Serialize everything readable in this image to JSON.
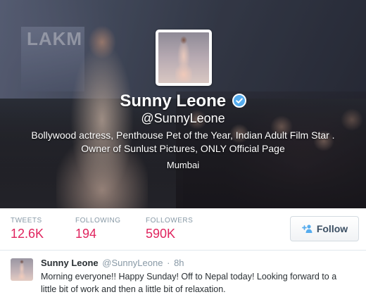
{
  "profile": {
    "name": "Sunny Leone",
    "handle": "@SunnyLeone",
    "bio_line1": "Bollywood actress, Penthouse Pet of the Year, Indian Adult Film Star .",
    "bio_line2": "Owner of Sunlust Pictures, ONLY Official Page",
    "location": "Mumbai",
    "banner_brand_text": "LAKM",
    "verified_icon": "verified-badge-icon"
  },
  "stats": [
    {
      "label": "TWEETS",
      "value": "12.6K"
    },
    {
      "label": "FOLLOWING",
      "value": "194"
    },
    {
      "label": "FOLLOWERS",
      "value": "590K"
    }
  ],
  "follow_button": {
    "label": "Follow",
    "icon": "add-user-icon"
  },
  "tweet": {
    "name": "Sunny Leone",
    "handle": "@SunnyLeone",
    "separator": "·",
    "time": "8h",
    "text": "Morning everyone!! Happy Sunday! Off to Nepal today! Looking forward to a little bit of work and then a little bit of relaxation."
  },
  "colors": {
    "accent": "#e0245e",
    "verified": "#55acee",
    "muted": "#8899a6",
    "text": "#292f33"
  }
}
